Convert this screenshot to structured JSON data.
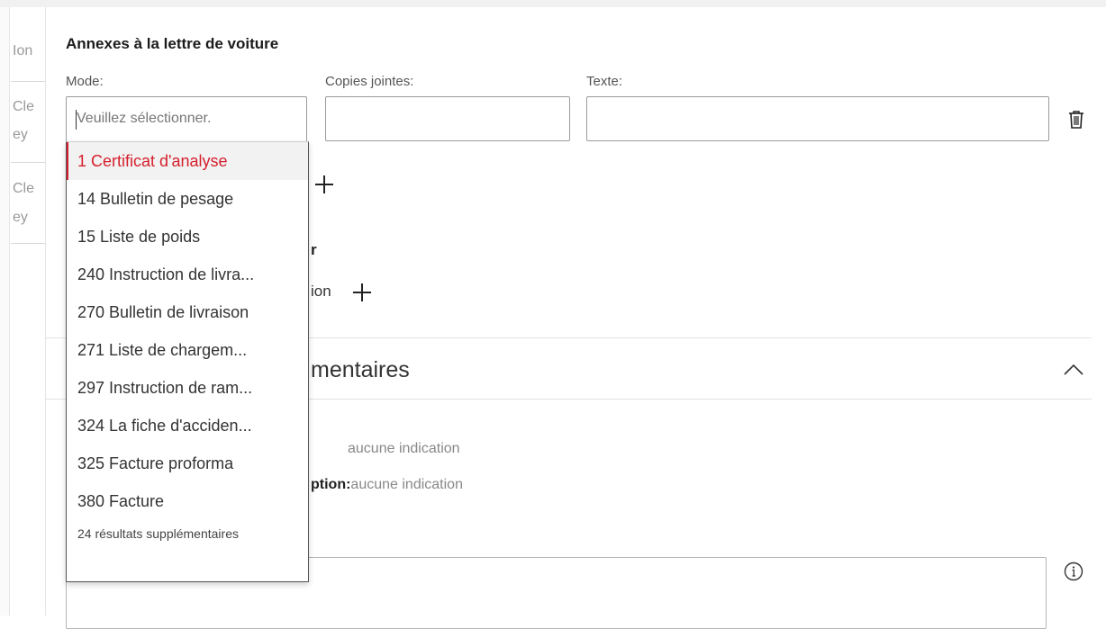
{
  "left_column": {
    "fragments": [
      "Ion",
      "Cle",
      "ey",
      "Cle",
      "ey"
    ]
  },
  "annexes": {
    "title": "Annexes à la lettre de voiture",
    "mode_label": "Mode:",
    "copies_label": "Copies jointes:",
    "texte_label": "Texte:",
    "mode_placeholder": "Veuillez sélectionner.",
    "copies_value": "",
    "texte_value": ""
  },
  "background": {
    "fragment_r": "r",
    "fragment_ion": "ion",
    "section_title_fragment": "mentaires",
    "value_1": "aucune indication",
    "label_fragment_2": "ption:",
    "value_2": "aucune indication"
  },
  "dropdown": {
    "items": [
      {
        "label": "1 Certificat d'analyse",
        "selected": true
      },
      {
        "label": "14 Bulletin de pesage",
        "selected": false
      },
      {
        "label": "15 Liste de poids",
        "selected": false
      },
      {
        "label": "240 Instruction de livra...",
        "selected": false
      },
      {
        "label": "270 Bulletin de livraison",
        "selected": false
      },
      {
        "label": "271 Liste de chargem...",
        "selected": false
      },
      {
        "label": "297 Instruction de ram...",
        "selected": false
      },
      {
        "label": "324 La fiche d'acciden...",
        "selected": false
      },
      {
        "label": "325 Facture proforma",
        "selected": false
      },
      {
        "label": "380 Facture",
        "selected": false
      }
    ],
    "more_results": "24 résultats supplémentaires"
  },
  "colors": {
    "accent_red": "#d5202d",
    "border": "#9b9b9b",
    "text_muted": "#777777"
  },
  "icons": [
    "trash-icon",
    "plus-icon",
    "chevron-up-icon",
    "info-icon"
  ]
}
